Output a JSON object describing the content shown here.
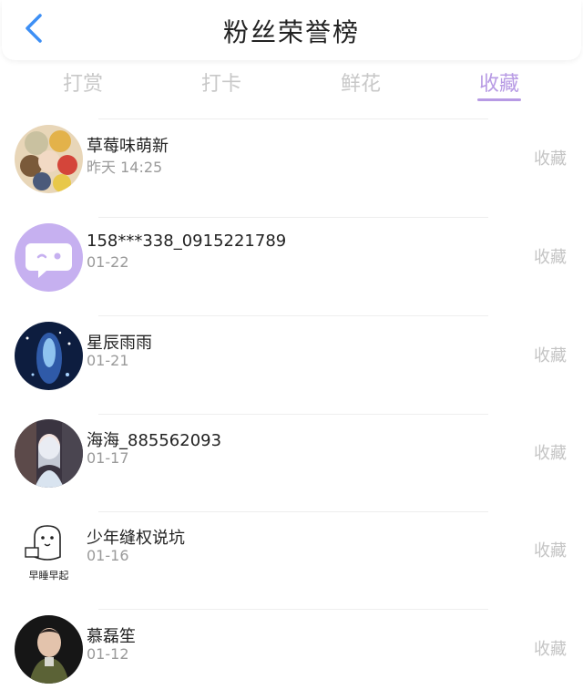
{
  "header": {
    "title": "粉丝荣誉榜",
    "back_icon": "chevron-left-icon",
    "back_color": "#3d8ff5"
  },
  "tabs": [
    {
      "label": "打赏",
      "active": false
    },
    {
      "label": "打卡",
      "active": false
    },
    {
      "label": "鲜花",
      "active": false
    },
    {
      "label": "收藏",
      "active": true
    }
  ],
  "accent_color": "#b79ae4",
  "list": [
    {
      "name": "草莓味萌新",
      "date": "昨天 14:25",
      "action": "收藏"
    },
    {
      "name": "158***338_0915221789",
      "date": "01-22",
      "action": "收藏"
    },
    {
      "name": "星辰雨雨",
      "date": "01-21",
      "action": "收藏"
    },
    {
      "name": "海海_885562093",
      "date": "01-17",
      "action": "收藏"
    },
    {
      "name": "少年缝权说坑",
      "date": "01-16",
      "action": "收藏",
      "avatar_text": "早睡早起"
    },
    {
      "name": "慕磊笙",
      "date": "01-12",
      "action": "收藏"
    }
  ]
}
